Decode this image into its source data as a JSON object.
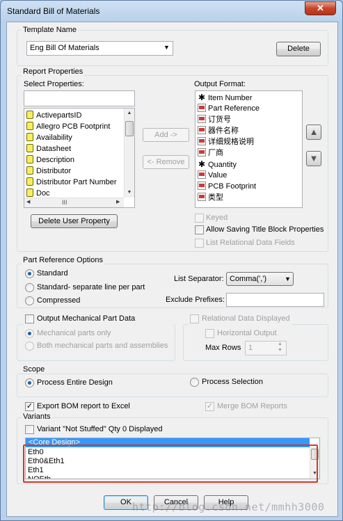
{
  "window": {
    "title": "Standard Bill of Materials",
    "close_glyph": "✕"
  },
  "template": {
    "label": "Template Name",
    "value": "Eng Bill Of Materials",
    "delete_label": "Delete"
  },
  "report": {
    "label": "Report Properties",
    "select_label": "Select Properties:",
    "search_value": "",
    "properties": [
      "ActivepartsID",
      "Allegro PCB Footprint",
      "Availability",
      "Datasheet",
      "Description",
      "Distributor",
      "Distributor Part Number",
      "Doc"
    ],
    "hscroll_thumb": "III",
    "add_label": "Add ->",
    "remove_label": "<- Remove",
    "output_label": "Output Format:",
    "output_items": [
      {
        "label": "Item Number",
        "icon": "asterisk"
      },
      {
        "label": "Part Reference",
        "icon": "property-icon"
      },
      {
        "label": "订货号",
        "icon": "property-icon"
      },
      {
        "label": "器件名称",
        "icon": "property-icon"
      },
      {
        "label": "详细规格说明",
        "icon": "property-icon"
      },
      {
        "label": "厂商",
        "icon": "property-icon"
      },
      {
        "label": "Quantity",
        "icon": "asterisk"
      },
      {
        "label": "Value",
        "icon": "property-icon"
      },
      {
        "label": "PCB Footprint",
        "icon": "property-icon"
      },
      {
        "label": "类型",
        "icon": "property-icon"
      }
    ],
    "move_up_glyph": "▲",
    "move_down_glyph": "▼",
    "delete_user_property_label": "Delete User Property",
    "keyed_label": "Keyed",
    "allow_saving_label": "Allow Saving Title Block Properties",
    "list_relational_label": "List Relational Data Fields"
  },
  "part_reference": {
    "label": "Part Reference Options",
    "options": [
      "Standard",
      "Standard- separate line per part",
      "Compressed"
    ],
    "selected": "Standard",
    "list_separator_label": "List Separator:",
    "list_separator_value": "Comma(',')",
    "exclude_prefixes_label": "Exclude Prefixes:",
    "exclude_prefixes_value": ""
  },
  "mechanical": {
    "label": "Output Mechanical Part Data",
    "options": [
      "Mechanical parts only",
      "Both mechanical parts and assemblies"
    ]
  },
  "relational": {
    "label": "Relational Data Displayed",
    "horizontal_label": "Horizontal Output",
    "max_rows_label": "Max Rows",
    "max_rows_value": "1"
  },
  "scope": {
    "label": "Scope",
    "options": [
      "Process Entire Design",
      "Process Selection"
    ],
    "selected": "Process Entire Design"
  },
  "export_label": "Export BOM report to Excel",
  "merge_label": "Merge BOM Reports",
  "variants": {
    "label": "Variants",
    "not_stuffed_label": "Variant \"Not Stuffed\" Qty 0 Displayed",
    "items": [
      "<Core Design>",
      "Eth0",
      "Eth0&Eth1",
      "Eth1",
      "NOEth"
    ]
  },
  "footer": {
    "ok": "OK",
    "cancel": "Cancel",
    "help": "Help"
  },
  "watermark": "http://blog.csdn.net/mmhh3000",
  "colors": {
    "selection": "#3399ff",
    "highlight_box": "#d2382c",
    "title_bar": "#b9d1ea"
  }
}
